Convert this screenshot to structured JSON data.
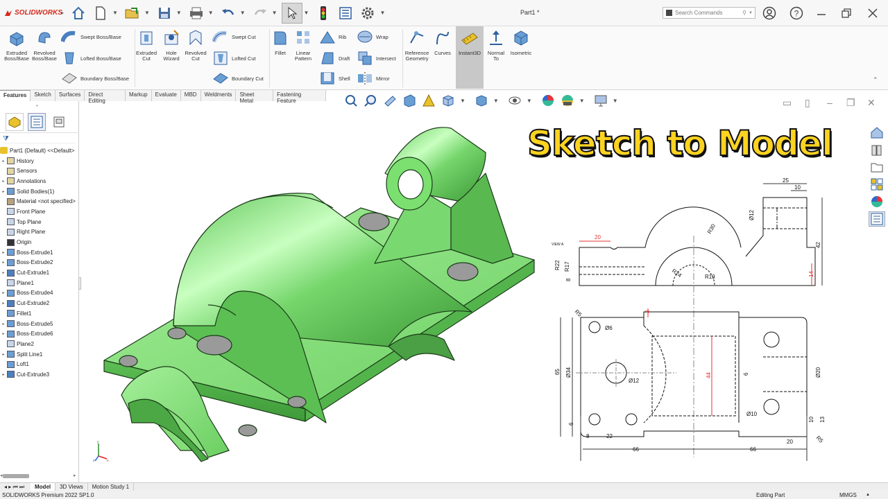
{
  "app": {
    "logo_text": "SOLIDWORKS",
    "doc_title": "Part1 *",
    "search_placeholder": "Search Commands"
  },
  "ribbon": {
    "extruded_boss": "Extruded Boss/Base",
    "revolved_boss": "Revolved Boss/Base",
    "swept_boss": "Swept Boss/Base",
    "lofted_boss": "Lofted Boss/Base",
    "boundary_boss": "Boundary Boss/Base",
    "extruded_cut": "Extruded Cut",
    "hole_wizard": "Hole Wizard",
    "revolved_cut": "Revolved Cut",
    "swept_cut": "Swept Cut",
    "lofted_cut": "Lofted Cut",
    "boundary_cut": "Boundary Cut",
    "fillet": "Fillet",
    "linear_pattern": "Linear Pattern",
    "rib": "Rib",
    "draft": "Draft",
    "shell": "Shell",
    "wrap": "Wrap",
    "intersect": "Intersect",
    "mirror": "Mirror",
    "reference_geometry": "Reference Geometry",
    "curves": "Curves",
    "instant3d": "Instant3D",
    "normal_to": "Normal To",
    "isometric": "Isometric"
  },
  "command_tabs": [
    "Features",
    "Sketch",
    "Surfaces",
    "Direct Editing",
    "Markup",
    "Evaluate",
    "MBD",
    "Weldments",
    "Sheet Metal",
    "Fastening Feature"
  ],
  "tree": {
    "root": "Part1 (Default) <<Default>",
    "items": [
      "History",
      "Sensors",
      "Annotations",
      "Solid Bodies(1)",
      "Material <not specified>",
      "Front Plane",
      "Top Plane",
      "Right Plane",
      "Origin",
      "Boss-Extrude1",
      "Boss-Extrude2",
      "Cut-Extrude1",
      "Plane1",
      "Boss-Extrude4",
      "Cut-Extrude2",
      "Fillet1",
      "Boss-Extrude5",
      "Boss-Extrude6",
      "Plane2",
      "Split Line1",
      "Loft1",
      "Cut-Extrude3"
    ]
  },
  "overlay": {
    "headline": "Sketch to Model"
  },
  "drawing": {
    "view_label": "VIEW A",
    "dims": [
      "25",
      "10",
      "Ø12",
      "42",
      "20",
      "R30",
      "R22",
      "R17",
      "8",
      "R24",
      "R19",
      "14",
      "R5",
      "3",
      "Ø6",
      "Ø34",
      "65",
      "Ø12",
      "44",
      "6",
      "Ø20",
      "Ø10",
      "10",
      "13",
      "6",
      "8",
      "22",
      "20",
      "R5",
      "66",
      "66"
    ]
  },
  "bottom_tabs": [
    "Model",
    "3D Views",
    "Motion Study 1"
  ],
  "status": {
    "product": "SOLIDWORKS Premium 2022 SP1.0",
    "mode": "Editing Part",
    "units": "MMGS"
  },
  "colors": {
    "model_green": "#72d66a",
    "headline_yellow": "#fbd320",
    "brand_red": "#d52b1e",
    "dim_red": "#e53030"
  }
}
